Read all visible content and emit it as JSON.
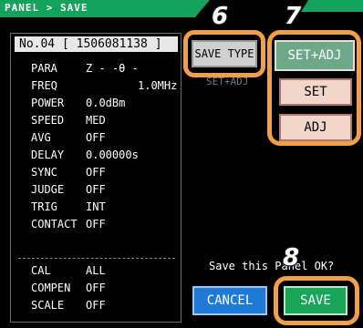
{
  "header": {
    "title": "PANEL > SAVE"
  },
  "panel": {
    "header": "No.04 [ 1506081138 ]",
    "rows": [
      {
        "key": "PARA",
        "value": "Z  -  -θ -"
      },
      {
        "key": "FREQ",
        "value": "1.0MHz"
      },
      {
        "key": "POWER",
        "value": "0.0dBm"
      },
      {
        "key": "SPEED",
        "value": "MED"
      },
      {
        "key": "AVG",
        "value": "OFF"
      },
      {
        "key": "DELAY",
        "value": "0.00000s"
      },
      {
        "key": "SYNC",
        "value": "OFF"
      },
      {
        "key": "JUDGE",
        "value": "OFF"
      },
      {
        "key": "TRIG",
        "value": "INT"
      },
      {
        "key": "CONTACT",
        "value": "OFF"
      }
    ],
    "rows2": [
      {
        "key": "CAL",
        "value": "ALL"
      },
      {
        "key": "COMPEN",
        "value": "OFF"
      },
      {
        "key": "SCALE",
        "value": "OFF"
      }
    ]
  },
  "buttons": {
    "save_type": "SAVE TYPE",
    "set_adj": "SET+ADJ",
    "set": "SET",
    "adj": "ADJ",
    "cancel": "CANCEL",
    "save": "SAVE"
  },
  "ghost_text": "SET+ADJ",
  "prompt": "Save this Panel OK?",
  "steps": {
    "s6": "6",
    "s7": "7",
    "s8": "8"
  },
  "colors": {
    "title_bar": "#13a35a",
    "highlight": "#f0a04b",
    "cancel": "#1f7ad6",
    "save": "#18a55a",
    "set_adj": "#6fa889",
    "set": "#f1d6c9"
  }
}
